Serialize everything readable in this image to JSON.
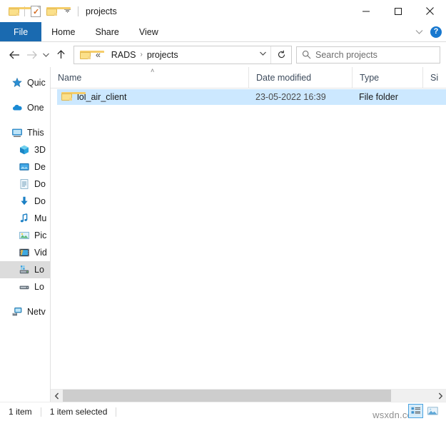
{
  "window": {
    "title": "projects",
    "quick_access": [
      {
        "name": "folder-icon",
        "label": "Folder"
      },
      {
        "name": "properties-icon",
        "label": "Properties"
      },
      {
        "name": "new-folder-icon",
        "label": "New folder"
      },
      {
        "name": "chevron-down-icon",
        "label": "Customize Quick Access Toolbar"
      }
    ],
    "controls": {
      "minimize": "–",
      "maximize": "☐",
      "close": "✕"
    }
  },
  "ribbon": {
    "tabs": [
      {
        "label": "File"
      },
      {
        "label": "Home"
      },
      {
        "label": "Share"
      },
      {
        "label": "View"
      }
    ],
    "collapse_chevron": "˅",
    "help_label": "?"
  },
  "address": {
    "back": "←",
    "forward": "→",
    "recent": "˅",
    "up": "↑",
    "breadcrumb_prefix": "«",
    "breadcrumb": [
      "RADS",
      "projects"
    ],
    "separator": "›",
    "dropdown": "˅",
    "refresh": "↻"
  },
  "search": {
    "placeholder": "Search projects",
    "icon": "search-icon"
  },
  "navigation": {
    "items": [
      {
        "label": "Quic",
        "icon": "quick-access-star-icon",
        "indent": false,
        "selected": false,
        "gap_after": true
      },
      {
        "label": "One",
        "icon": "onedrive-cloud-icon",
        "indent": false,
        "selected": false,
        "gap_after": true
      },
      {
        "label": "This",
        "icon": "this-pc-monitor-icon",
        "indent": false,
        "selected": false,
        "gap_after": false
      },
      {
        "label": "3D",
        "icon": "3d-objects-icon",
        "indent": true,
        "selected": false,
        "gap_after": false
      },
      {
        "label": "De",
        "icon": "desktop-icon",
        "indent": true,
        "selected": false,
        "gap_after": false
      },
      {
        "label": "Do",
        "icon": "documents-icon",
        "indent": true,
        "selected": false,
        "gap_after": false
      },
      {
        "label": "Do",
        "icon": "downloads-icon",
        "indent": true,
        "selected": false,
        "gap_after": false
      },
      {
        "label": "Mu",
        "icon": "music-icon",
        "indent": true,
        "selected": false,
        "gap_after": false
      },
      {
        "label": "Pic",
        "icon": "pictures-icon",
        "indent": true,
        "selected": false,
        "gap_after": false
      },
      {
        "label": "Vid",
        "icon": "videos-icon",
        "indent": true,
        "selected": false,
        "gap_after": false
      },
      {
        "label": "Lo",
        "icon": "local-disk-c-icon",
        "indent": true,
        "selected": true,
        "gap_after": false
      },
      {
        "label": "Lo",
        "icon": "local-disk-d-icon",
        "indent": true,
        "selected": false,
        "gap_after": true
      },
      {
        "label": "Netv",
        "icon": "network-icon",
        "indent": false,
        "selected": false,
        "gap_after": false
      }
    ]
  },
  "filelist": {
    "columns": [
      {
        "label": "Name",
        "sorted": "asc",
        "sort_caret": "˄"
      },
      {
        "label": "Date modified",
        "sorted": ""
      },
      {
        "label": "Type",
        "sorted": ""
      },
      {
        "label": "Si",
        "sorted": ""
      }
    ],
    "rows": [
      {
        "icon": "folder-icon",
        "name": "lol_air_client",
        "date_modified": "23-05-2022 16:39",
        "type": "File folder",
        "size": "",
        "selected": true
      }
    ]
  },
  "scrollbar": {
    "left_arrow": "‹",
    "right_arrow": "›"
  },
  "statusbar": {
    "item_count": "1 item",
    "selection_count": "1 item selected",
    "views": [
      {
        "name": "details-view-button",
        "active": true
      },
      {
        "name": "large-icons-view-button",
        "active": false
      }
    ]
  },
  "watermark": {
    "text": "wsxdn.com"
  },
  "colors": {
    "file_tab_blue": "#1a6ab0",
    "selection_blue": "#cce8ff",
    "nav_selected_grey": "#dcdcdc",
    "help_blue": "#1878cf",
    "folder_yellow": "#fbe08a"
  }
}
